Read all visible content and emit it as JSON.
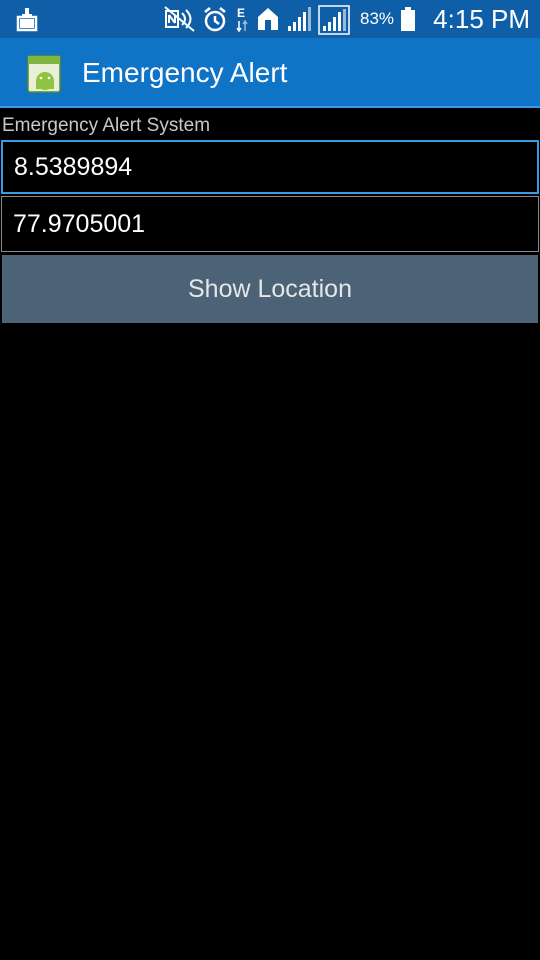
{
  "status_bar": {
    "battery_percent": "83%",
    "time": "4:15 PM",
    "icons": [
      "cleaner-icon",
      "nfc-icon",
      "alarm-icon",
      "edge-data-icon",
      "home-icon",
      "signal-icon",
      "signal-icon",
      "battery-icon"
    ]
  },
  "action_bar": {
    "title": "Emergency Alert",
    "app_icon": "android-app-icon"
  },
  "main": {
    "subtitle": "Emergency Alert System",
    "latitude_value": "8.5389894",
    "longitude_value": "77.9705001",
    "show_location_label": "Show Location"
  },
  "colors": {
    "status_bar": "#0f5fa8",
    "action_bar": "#0f73c6",
    "focused_border": "#3a9be3",
    "button_bg": "#4c6276",
    "background": "#000000"
  }
}
